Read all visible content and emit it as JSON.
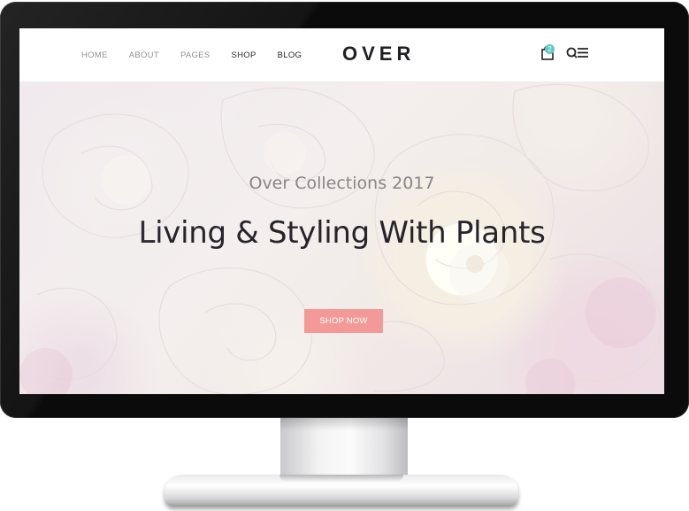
{
  "nav": {
    "items": [
      {
        "label": "HOME",
        "active": false
      },
      {
        "label": "ABOUT",
        "active": false
      },
      {
        "label": "PAGES",
        "active": false
      },
      {
        "label": "SHOP",
        "active": true
      },
      {
        "label": "BLOG",
        "active": true
      }
    ]
  },
  "brand": {
    "logo": "OVER"
  },
  "header_icons": {
    "cart_icon": "shopping-bag-icon",
    "cart_count": "2",
    "search_icon": "search-icon",
    "menu_icon": "menu-icon"
  },
  "hero": {
    "kicker": "Over Collections 2017",
    "headline": "Living & Styling With Plants",
    "cta_label": "SHOP NOW"
  },
  "colors": {
    "cta_background": "#f39a99",
    "badge": "#5ec9c6",
    "text_dark": "#26242a"
  }
}
